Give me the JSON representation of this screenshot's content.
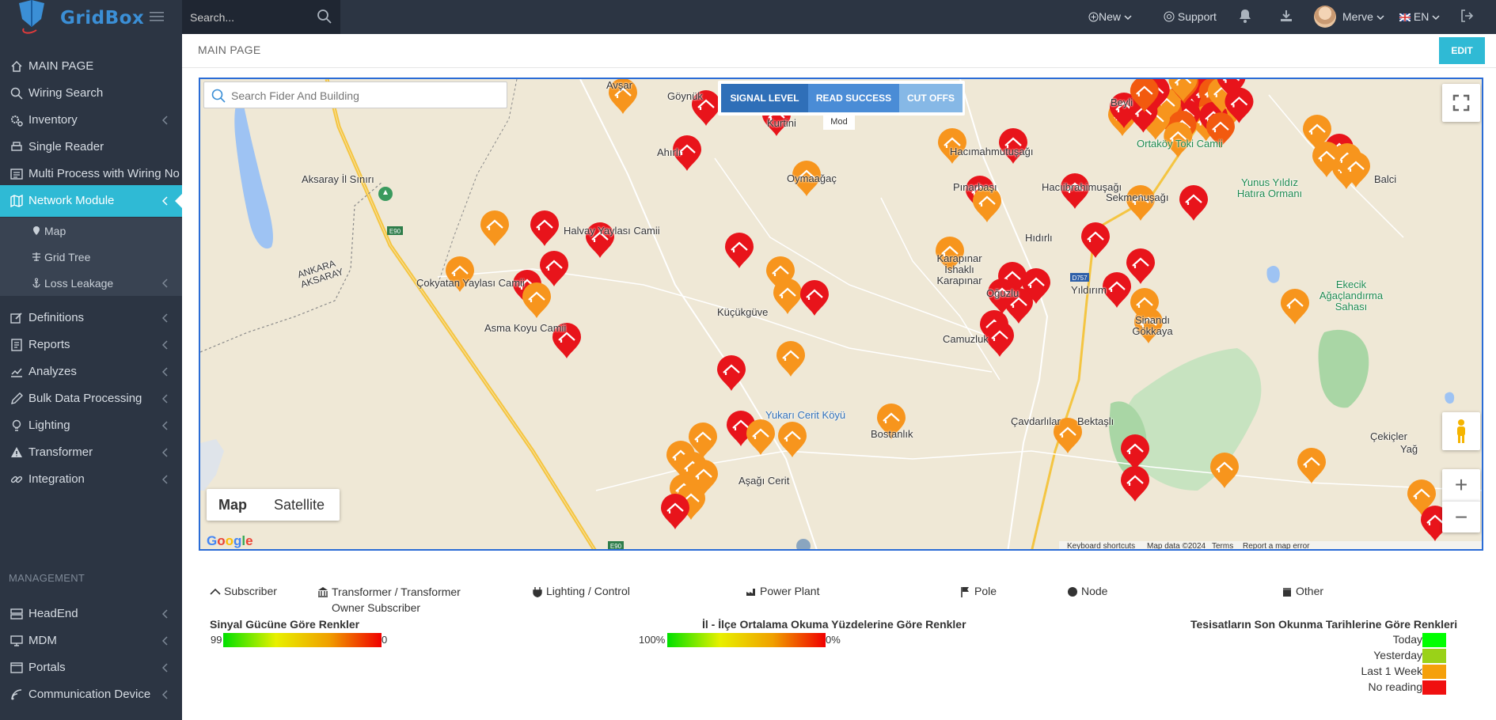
{
  "brand": {
    "name": "GridBox"
  },
  "search": {
    "placeholder": "Search..."
  },
  "topbar": {
    "new_label": "New",
    "support_label": "Support",
    "user_name": "Merve",
    "language": "EN"
  },
  "sidebar": {
    "items": [
      {
        "label": "MAIN PAGE",
        "icon": "home-icon"
      },
      {
        "label": "Wiring Search",
        "icon": "search-icon"
      },
      {
        "label": "Inventory",
        "icon": "cogs-icon"
      },
      {
        "label": "Single Reader",
        "icon": "print-icon"
      },
      {
        "label": "Multi Process with Wiring No",
        "icon": "list-icon"
      },
      {
        "label": "Network Module",
        "icon": "map-icon"
      }
    ],
    "subitems": [
      {
        "label": "Map",
        "icon": "map-marker-icon"
      },
      {
        "label": "Grid Tree",
        "icon": "tree-icon"
      },
      {
        "label": "Loss Leakage",
        "icon": "anchor-icon"
      }
    ],
    "items2": [
      {
        "label": "Definitions",
        "icon": "edit-icon"
      },
      {
        "label": "Reports",
        "icon": "report-icon"
      },
      {
        "label": "Analyzes",
        "icon": "chart-icon"
      },
      {
        "label": "Bulk Data Processing",
        "icon": "pencil-icon"
      },
      {
        "label": "Lighting",
        "icon": "bulb-icon"
      },
      {
        "label": "Transformer",
        "icon": "warning-icon"
      },
      {
        "label": "Integration",
        "icon": "link-icon"
      }
    ],
    "management_header": "MANAGEMENT",
    "items3": [
      {
        "label": "HeadEnd",
        "icon": "server-icon"
      },
      {
        "label": "MDM",
        "icon": "monitor-icon"
      },
      {
        "label": "Portals",
        "icon": "window-icon"
      },
      {
        "label": "Communication Device",
        "icon": "signal-icon"
      }
    ]
  },
  "header": {
    "title": "MAIN PAGE",
    "edit_label": "EDIT"
  },
  "map": {
    "search_placeholder": "Search Fider And Building",
    "modes": [
      "SIGNAL LEVEL",
      "READ SUCCESS",
      "CUT OFFS"
    ],
    "mode_label": "Mod",
    "map_types": [
      "Map",
      "Satellite"
    ],
    "google": "Google",
    "attribution": [
      "Keyboard shortcuts",
      "Map data ©2024",
      "Terms",
      "Report a map error"
    ],
    "place_labels": [
      {
        "t": "Avşar"
      },
      {
        "t": "Göynük"
      },
      {
        "t": "Kurtini"
      },
      {
        "t": "Ahırlı"
      },
      {
        "t": "Oymaağaç"
      },
      {
        "t": "Hacımahmutuşağı"
      },
      {
        "t": "Pınarbaşı"
      },
      {
        "t": "Hacıibrahimuşağı"
      },
      {
        "t": "Sekmenuşağı"
      },
      {
        "t": "Ortaköy Toki Camii"
      },
      {
        "t": "Yunus Yıldız Hatıra Ormanı"
      },
      {
        "t": "Balci"
      },
      {
        "t": "Aksaray İl Sınırı"
      },
      {
        "t": "Halvay Yaylası Camii"
      },
      {
        "t": "Hıdırlı"
      },
      {
        "t": "ANKARA AKSARAY"
      },
      {
        "t": "Çokyatan Yaylası Camii"
      },
      {
        "t": "Karapınar İshaklı Karapınar"
      },
      {
        "t": "Oğuzlu"
      },
      {
        "t": "Yıldırım"
      },
      {
        "t": "Küçükgüve"
      },
      {
        "t": "Sinandı Gökkaya"
      },
      {
        "t": "Ekecik Ağaçlandırma Sahası"
      },
      {
        "t": "Asma Koyu Camii"
      },
      {
        "t": "Camuzluk"
      },
      {
        "t": "Yukarı Cerit Köyü"
      },
      {
        "t": "Bostanlık"
      },
      {
        "t": "Çavdarlılar"
      },
      {
        "t": "Bektaşlı"
      },
      {
        "t": "Çekiçler"
      },
      {
        "t": "Aşağı Cerit"
      },
      {
        "t": "E90"
      },
      {
        "t": "D757"
      },
      {
        "t": "Beyli"
      },
      {
        "t": "Yağ"
      }
    ],
    "marker_colors": {
      "red": "#e8141b",
      "dark_orange": "#f25a0f",
      "orange": "#f7951d"
    }
  },
  "legend": {
    "types": [
      {
        "label": "Subscriber",
        "icon": "house-roof-icon"
      },
      {
        "label": "Transformer / Transformer Owner Subscriber",
        "icon": "bank-icon"
      },
      {
        "label": "Lighting / Control",
        "icon": "plug-icon"
      },
      {
        "label": "Power Plant",
        "icon": "power-plant-icon"
      },
      {
        "label": "Pole",
        "icon": "flag-icon"
      },
      {
        "label": "Node",
        "icon": "circle-icon"
      },
      {
        "label": "Other",
        "icon": "box-icon"
      }
    ],
    "signal": {
      "title": "Sinyal Gücüne Göre Renkler",
      "min": "99",
      "max": "0"
    },
    "read": {
      "title": "İl - İlçe Ortalama Okuma Yüzdelerine Göre Renkler",
      "min": "100%",
      "max": "0%"
    },
    "recency": {
      "title": "Tesisatların Son Okunma Tarihlerine Göre Renkleri",
      "items": [
        {
          "label": "Today",
          "color": "#00ff00"
        },
        {
          "label": "Yesterday",
          "color": "#9ad218"
        },
        {
          "label": "Last 1 Week",
          "color": "#f5a00a"
        },
        {
          "label": "No reading",
          "color": "#f01010"
        }
      ]
    }
  }
}
